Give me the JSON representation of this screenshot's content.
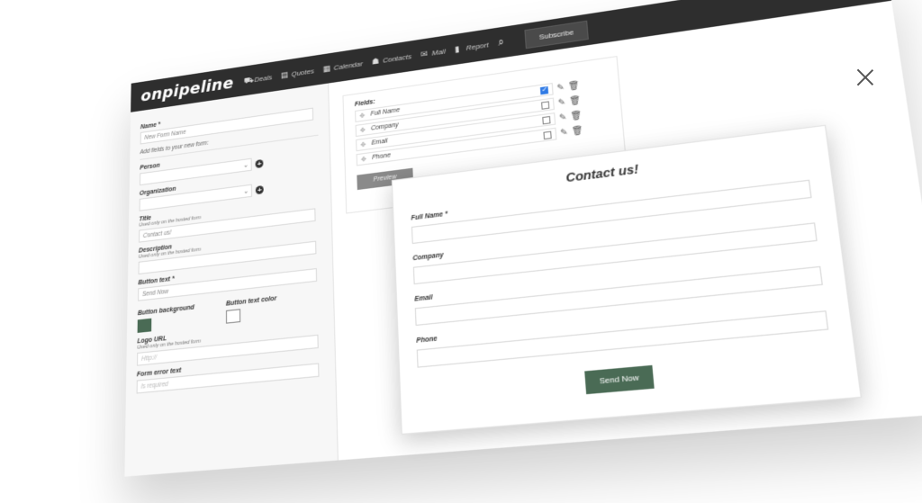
{
  "app": {
    "logo": "onpipeline",
    "subscribe_label": "Subscribe"
  },
  "nav": {
    "items": [
      {
        "label": "Deals",
        "icon": "deals-icon",
        "glyph": "⛟"
      },
      {
        "label": "Quotes",
        "icon": "quotes-icon",
        "glyph": "▤"
      },
      {
        "label": "Calendar",
        "icon": "calendar-icon",
        "glyph": "▦"
      },
      {
        "label": "Contacts",
        "icon": "contacts-icon",
        "glyph": "☗"
      },
      {
        "label": "Mail",
        "icon": "mail-icon",
        "glyph": "✉"
      },
      {
        "label": "Report",
        "icon": "report-icon",
        "glyph": "▮"
      }
    ]
  },
  "form": {
    "name_label": "Name *",
    "name_placeholder": "New Form Name",
    "add_fields_hint": "Add fields to your new form:",
    "person_label": "Person",
    "organization_label": "Organization",
    "title_label": "Title",
    "title_sub": "Used only on the hosted form",
    "title_value": "Contact us!",
    "description_label": "Description",
    "description_sub": "Used only on the hosted form",
    "button_text_label": "Button text *",
    "button_text_value": "Send Now",
    "button_background_label": "Button background",
    "button_text_color_label": "Button text color",
    "logo_url_label": "Logo URL",
    "logo_url_sub": "Used only on the hosted form",
    "logo_url_placeholder": "Http://",
    "error_label": "Form error text",
    "error_placeholder": "Is required"
  },
  "fields": {
    "label": "Fields:",
    "items": [
      {
        "name": "Full Name",
        "checked": true
      },
      {
        "name": "Company",
        "checked": false
      },
      {
        "name": "Email",
        "checked": false
      },
      {
        "name": "Phone",
        "checked": false
      }
    ],
    "preview_label": "Preview"
  },
  "preview": {
    "title": "Contact us!",
    "labels": [
      "Full Name *",
      "Company",
      "Email",
      "Phone"
    ],
    "button": "Send Now"
  },
  "colors": {
    "button_bg": "#4a6b55",
    "nav_bg": "#2e2e2e",
    "check_blue": "#2f7ae5"
  }
}
